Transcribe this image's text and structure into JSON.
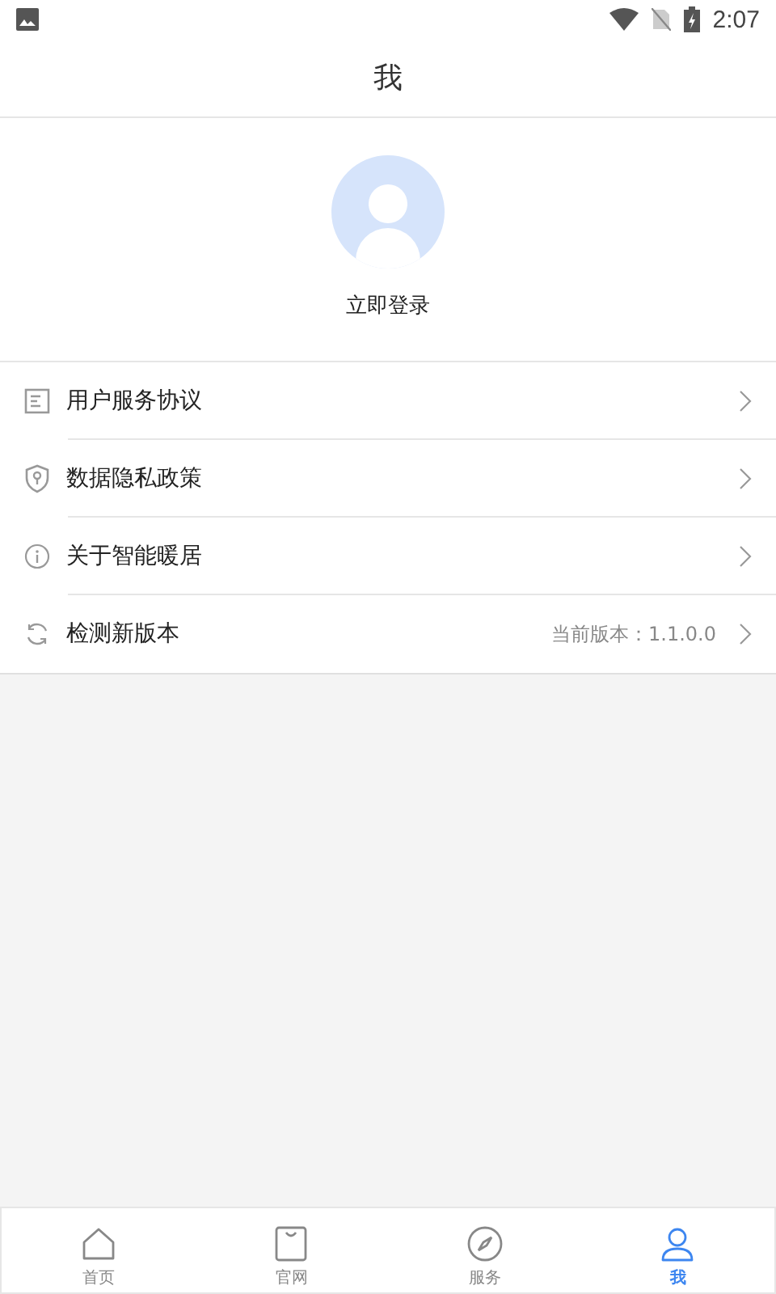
{
  "status_bar": {
    "time": "2:07"
  },
  "header": {
    "title": "我"
  },
  "profile": {
    "login": "立即登录"
  },
  "menu": [
    {
      "kind": "document",
      "label": "用户服务协议"
    },
    {
      "kind": "shield",
      "label": "数据隐私政策"
    },
    {
      "kind": "info",
      "label": "关于智能暖居"
    },
    {
      "kind": "refresh",
      "label": "检测新版本",
      "value": "当前版本：1.1.0.0"
    }
  ],
  "tabs": [
    {
      "kind": "home",
      "label": "首页",
      "selected": false
    },
    {
      "kind": "bag",
      "label": "官网",
      "selected": false
    },
    {
      "kind": "compass",
      "label": "服务",
      "selected": false
    },
    {
      "kind": "person",
      "label": "我",
      "selected": true
    }
  ]
}
